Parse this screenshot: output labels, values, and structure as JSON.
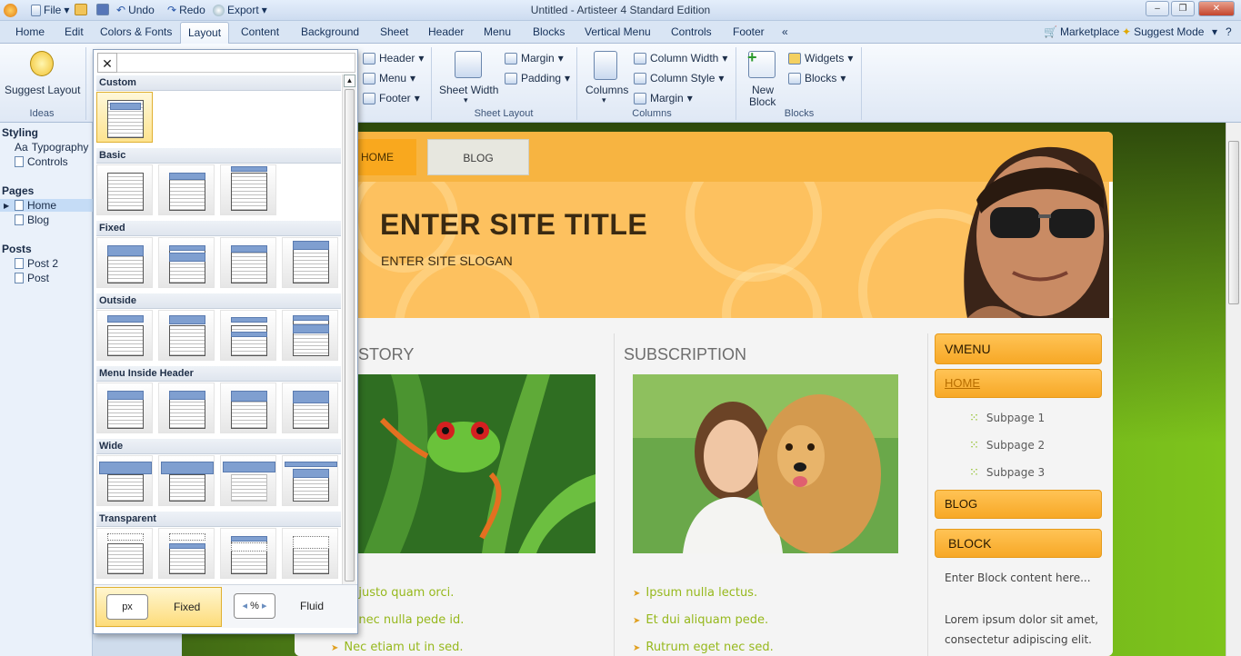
{
  "app": {
    "title": "Untitled - Artisteer 4 Standard Edition",
    "quick_access": {
      "file": "File",
      "undo": "Undo",
      "redo": "Redo",
      "export": "Export"
    }
  },
  "tabs": [
    "Home",
    "Edit",
    "Colors & Fonts",
    "Layout",
    "Content",
    "Background",
    "Sheet",
    "Header",
    "Menu",
    "Blocks",
    "Vertical Menu",
    "Controls",
    "Footer",
    "«"
  ],
  "active_tab": "Layout",
  "right_tools": {
    "marketplace": "Marketplace",
    "suggest_mode": "Suggest Mode"
  },
  "ribbon": {
    "ideas": {
      "button": "Suggest Layout",
      "label": "Ideas"
    },
    "position": {
      "header": "Header",
      "menu": "Menu",
      "footer": "Footer"
    },
    "sheet_layout": {
      "sheet_width": "Sheet Width",
      "margin": "Margin",
      "padding": "Padding",
      "label": "Sheet Layout"
    },
    "columns": {
      "columns": "Columns",
      "column_width": "Column Width",
      "column_style": "Column Style",
      "margin": "Margin",
      "label": "Columns"
    },
    "blocks": {
      "new_block_1": "New",
      "new_block_2": "Block",
      "widgets": "Widgets",
      "blocks": "Blocks",
      "label": "Blocks"
    }
  },
  "left_panel": {
    "styling": "Styling",
    "typography_prefix": "Aa",
    "typography": "Typography",
    "controls": "Controls",
    "pages": "Pages",
    "home": "Home",
    "blog": "Blog",
    "posts": "Posts",
    "post2": "Post 2",
    "post": "Post"
  },
  "gallery": {
    "sections": [
      "Custom",
      "Basic",
      "Fixed",
      "Outside",
      "Menu Inside Header",
      "Wide",
      "Transparent"
    ],
    "footer": {
      "px": "px",
      "fixed": "Fixed",
      "percent": "%",
      "fluid": "Fluid"
    }
  },
  "site": {
    "nav": [
      "HOME",
      "BLOG"
    ],
    "title": "ENTER SITE TITLE",
    "slogan": "ENTER SITE SLOGAN",
    "col1_title": "STORY",
    "col2_title": "SUBSCRIPTION",
    "col1_bullets": [
      "justo quam orci.",
      "nec nulla pede id.",
      "Nec etiam ut in sed."
    ],
    "col2_bullets": [
      "Ipsum nulla lectus.",
      "Et dui aliquam pede.",
      "Rutrum eget nec sed."
    ],
    "vmenu_title": "VMENU",
    "vmenu_home": "HOME",
    "vmenu_subpages": [
      "Subpage 1",
      "Subpage 2",
      "Subpage 3"
    ],
    "vmenu_blog": "BLOG",
    "block_title": "BLOCK",
    "block_text1": "Enter Block content here...",
    "block_text2": "Lorem ipsum dolor sit amet,",
    "block_text3": "consectetur adipiscing elit."
  },
  "colors": {
    "accent": "#f7b441",
    "ribbon": "#dfe8f5",
    "canvas_green": "#7ec41c"
  }
}
